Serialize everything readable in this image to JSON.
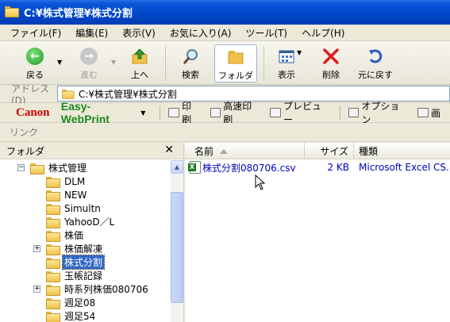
{
  "window": {
    "title": "C:¥株式管理¥株式分割"
  },
  "menu": [
    "ファイル(F)",
    "編集(E)",
    "表示(V)",
    "お気に入り(A)",
    "ツール(T)",
    "ヘルプ(H)"
  ],
  "toolbar": {
    "back": "戻る",
    "forward": "進む",
    "up": "上へ",
    "search": "検索",
    "folders": "フォルダ",
    "views": "表示",
    "delete": "削除",
    "undo": "元に戻す"
  },
  "address": {
    "label": "アドレス(D)",
    "value": "C:¥株式管理¥株式分割"
  },
  "canon_bar": {
    "brand": "Canon",
    "product": "Easy-WebPrint",
    "print": "印刷",
    "hq_print": "高速印刷",
    "preview": "プレビュー",
    "options": "オプション",
    "partial": "画"
  },
  "links": {
    "label": "リンク"
  },
  "folder_pane": {
    "title": "フォルダ",
    "items": [
      {
        "label": "株式管理",
        "level": 0,
        "expander": "−"
      },
      {
        "label": "DLM",
        "level": 1
      },
      {
        "label": "NEW",
        "level": 1
      },
      {
        "label": "Simultn",
        "level": 1
      },
      {
        "label": "YahooD／L",
        "level": 1
      },
      {
        "label": "株価",
        "level": 1
      },
      {
        "label": "株価解凍",
        "level": 1,
        "expander": "+"
      },
      {
        "label": "株式分割",
        "level": 1,
        "selected": true
      },
      {
        "label": "玉帳記録",
        "level": 1
      },
      {
        "label": "時系列株価080706",
        "level": 1,
        "expander": "+"
      },
      {
        "label": "週足08",
        "level": 1
      },
      {
        "label": "週足54",
        "level": 1
      }
    ]
  },
  "file_list": {
    "columns": {
      "name": "名前",
      "size": "サイズ",
      "type": "種類"
    },
    "rows": [
      {
        "name": "株式分割080706.csv",
        "size": "2 KB",
        "type": "Microsoft Excel CS..."
      }
    ]
  }
}
